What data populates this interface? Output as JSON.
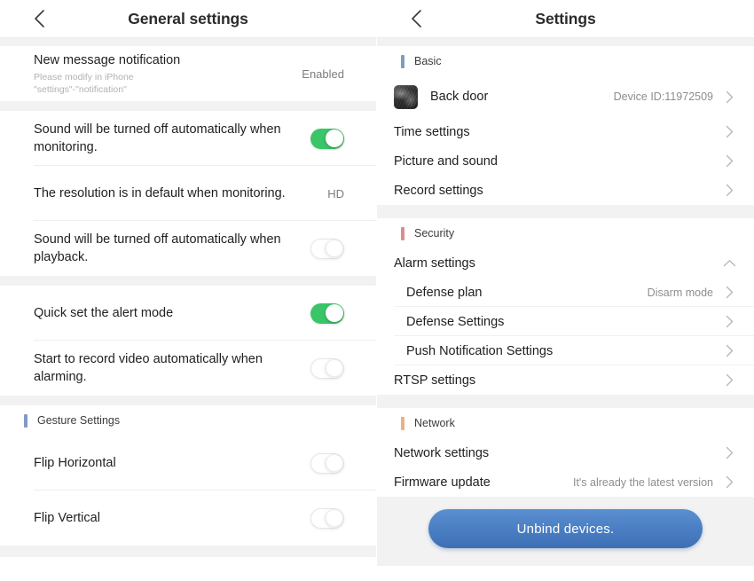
{
  "colors": {
    "toggle_on": "#3ac569",
    "accent_basic": "#7f9cc4",
    "accent_security": "#e08b8b",
    "accent_network": "#eeb07f",
    "button_blue": "#4a7fc4",
    "section_gap": "#f2f2f2"
  },
  "left_screen": {
    "nav": {
      "back_icon": "chevron-left-icon",
      "title": "General settings"
    },
    "rows": [
      {
        "title": "New message notification",
        "subtitle": "Please modify in iPhone\n\"settings\"-\"notification\"",
        "value": "Enabled",
        "control": "value"
      },
      {
        "title": "Sound will be turned off automatically when monitoring.",
        "control": "toggle",
        "state": "on"
      },
      {
        "title": "The resolution is in default when monitoring.",
        "value": "HD",
        "control": "value"
      },
      {
        "title": "Sound will be turned off automatically when playback.",
        "control": "toggle",
        "state": "off"
      },
      {
        "title": "Quick set the alert mode",
        "control": "toggle",
        "state": "on"
      },
      {
        "title": "Start to record video automatically when alarming.",
        "control": "toggle",
        "state": "off"
      }
    ],
    "gesture_section": {
      "label": "Gesture Settings",
      "accent": "#7f9cc4",
      "rows": [
        {
          "title": "Flip Horizontal",
          "control": "toggle",
          "state": "off"
        },
        {
          "title": "Flip Vertical",
          "control": "toggle",
          "state": "off"
        }
      ]
    }
  },
  "right_screen": {
    "nav": {
      "back_icon": "chevron-left-icon",
      "title": "Settings"
    },
    "sections": [
      {
        "label": "Basic",
        "accent": "#7f9cc4",
        "rows": [
          {
            "label": "Back door",
            "value": "Device ID:11972509",
            "thumb": "camera-snapshot-thumbnail",
            "chevron": "chevron-right-icon"
          },
          {
            "label": "Time settings",
            "value": "",
            "chevron": "chevron-right-icon"
          },
          {
            "label": "Picture and sound",
            "value": "",
            "chevron": "chevron-right-icon"
          },
          {
            "label": "Record settings",
            "value": "",
            "chevron": "chevron-right-icon"
          }
        ]
      },
      {
        "label": "Security",
        "accent": "#e08b8b",
        "rows": [
          {
            "label": "Alarm settings",
            "value": "",
            "chevron": "chevron-up-icon"
          },
          {
            "label": "Defense plan",
            "value": "Disarm mode",
            "chevron": "chevron-right-icon",
            "indent": true
          },
          {
            "label": "Defense Settings",
            "value": "",
            "chevron": "chevron-right-icon",
            "indent": true
          },
          {
            "label": "Push Notification Settings",
            "value": "",
            "chevron": "chevron-right-icon",
            "indent": true
          },
          {
            "label": "RTSP settings",
            "value": "",
            "chevron": "chevron-right-icon"
          }
        ]
      },
      {
        "label": "Network",
        "accent": "#eeb07f",
        "rows": [
          {
            "label": "Network settings",
            "value": "",
            "chevron": "chevron-right-icon"
          },
          {
            "label": "Firmware update",
            "value": "It's already the latest version",
            "chevron": "chevron-right-icon"
          }
        ]
      }
    ],
    "unbind_button": "Unbind devices."
  }
}
